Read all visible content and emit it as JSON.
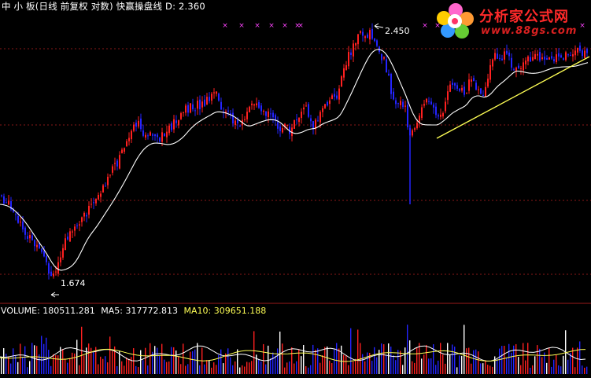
{
  "header": {
    "title": "中 小 板(日线 前复权 对数) 快赢操盘线",
    "d_label": "D:",
    "d_value": "2.360"
  },
  "volume_header": {
    "volume_label": "VOLUME:",
    "volume_value": "180511.281",
    "ma5_label": "MA5:",
    "ma5_value": "317772.813",
    "ma10_label": "MA10:",
    "ma10_value": "309651.188"
  },
  "logo": {
    "title": "分析家公式网",
    "url": "www.88gs.com"
  },
  "annotations": {
    "high_label": "2.450",
    "low_label": "1.674"
  },
  "colors": {
    "background": "#000000",
    "up_candle": "#ff2020",
    "down_candle": "#2424ff",
    "ma_line": "#ffffff",
    "trendline": "#ffff55",
    "grid": "#8a1818",
    "marker": "#ff44ff",
    "vol_ma5": "#ffffff",
    "vol_ma10": "#ffff55"
  },
  "chart_data": {
    "type": "candlestick",
    "y_scale": "log",
    "ylim": [
      1.6,
      2.5
    ],
    "high_value": 2.45,
    "low_value": 1.674,
    "last_value": 2.36,
    "marker_glyph": "×",
    "grid": true,
    "series": [
      {
        "name": "VOLUME",
        "value": 180511.281
      },
      {
        "name": "MA5",
        "value": 317772.813
      },
      {
        "name": "MA10",
        "value": 309651.188
      }
    ]
  }
}
